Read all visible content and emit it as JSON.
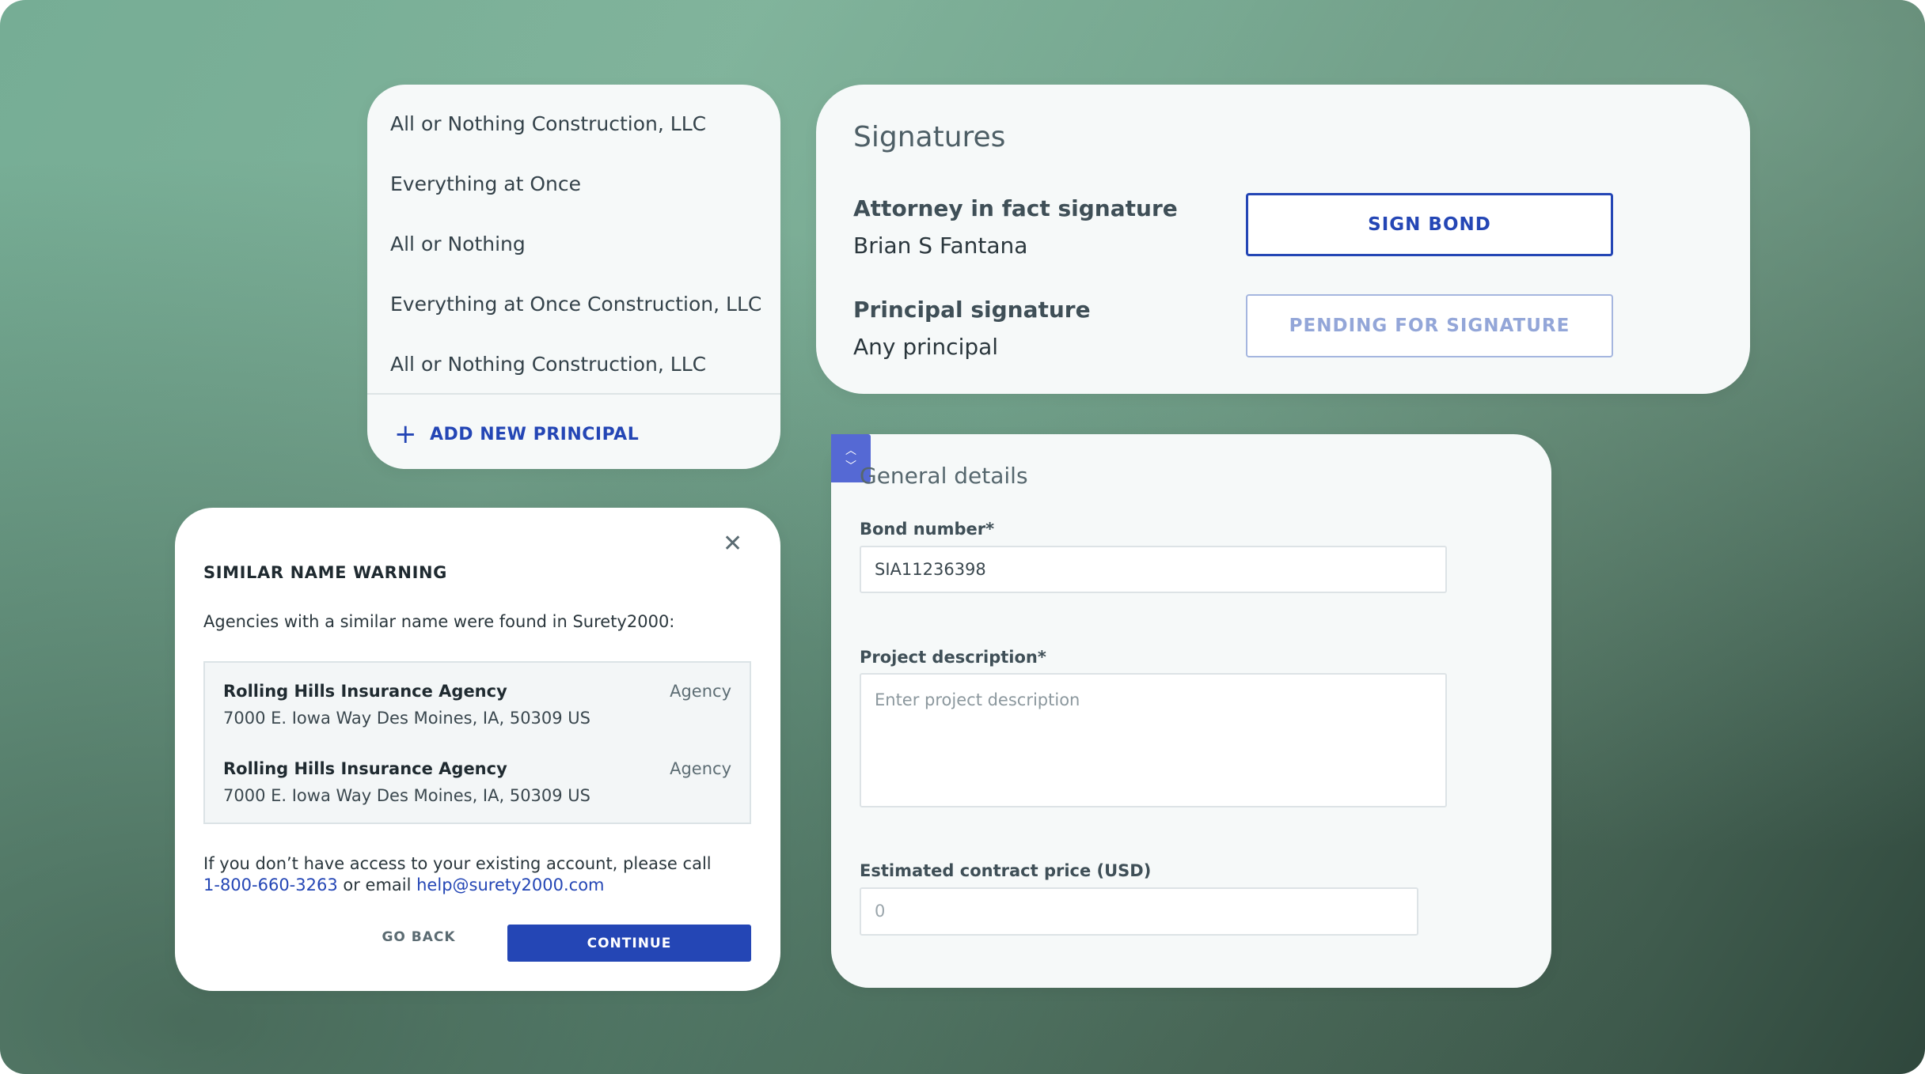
{
  "principals": {
    "items": [
      "All or Nothing Construction, LLC",
      "Everything at Once",
      "All or Nothing",
      "Everything at Once Construction, LLC",
      "All or Nothing Construction, LLC"
    ],
    "add_label": "ADD NEW PRINCIPAL"
  },
  "signatures": {
    "title": "Signatures",
    "rows": [
      {
        "label": "Attorney in fact signature",
        "name": "Brian S Fantana",
        "button": "SIGN BOND"
      },
      {
        "label": "Principal signature",
        "name": "Any principal",
        "button": "PENDING FOR SIGNATURE"
      }
    ]
  },
  "warning": {
    "title": "SIMILAR NAME WARNING",
    "body": "Agencies with a similar name were found in Surety2000:",
    "agencies": [
      {
        "name": "Rolling Hills Insurance Agency",
        "address": "7000 E. Iowa Way Des Moines, IA, 50309 US",
        "type": "Agency"
      },
      {
        "name": "Rolling Hills Insurance Agency",
        "address": "7000 E. Iowa Way Des Moines, IA, 50309 US",
        "type": "Agency"
      }
    ],
    "help_prefix": "If you don’t have access to your existing account, please call",
    "phone": "1-800-660-3263",
    "help_mid": " or email ",
    "email": "help@surety2000.com",
    "go_back": "GO BACK",
    "continue": "CONTINUE"
  },
  "details": {
    "title": "General details",
    "bond_label": "Bond number*",
    "bond_value": "SIA11236398",
    "desc_label": "Project description*",
    "desc_placeholder": "Enter project description",
    "price_label": "Estimated contract price (USD)",
    "price_value": "0"
  },
  "colors": {
    "accent": "#2446b5",
    "stepper": "#5569d4"
  },
  "icons": [
    "plus-icon",
    "close-icon",
    "chevron-up-icon",
    "chevron-down-icon"
  ]
}
